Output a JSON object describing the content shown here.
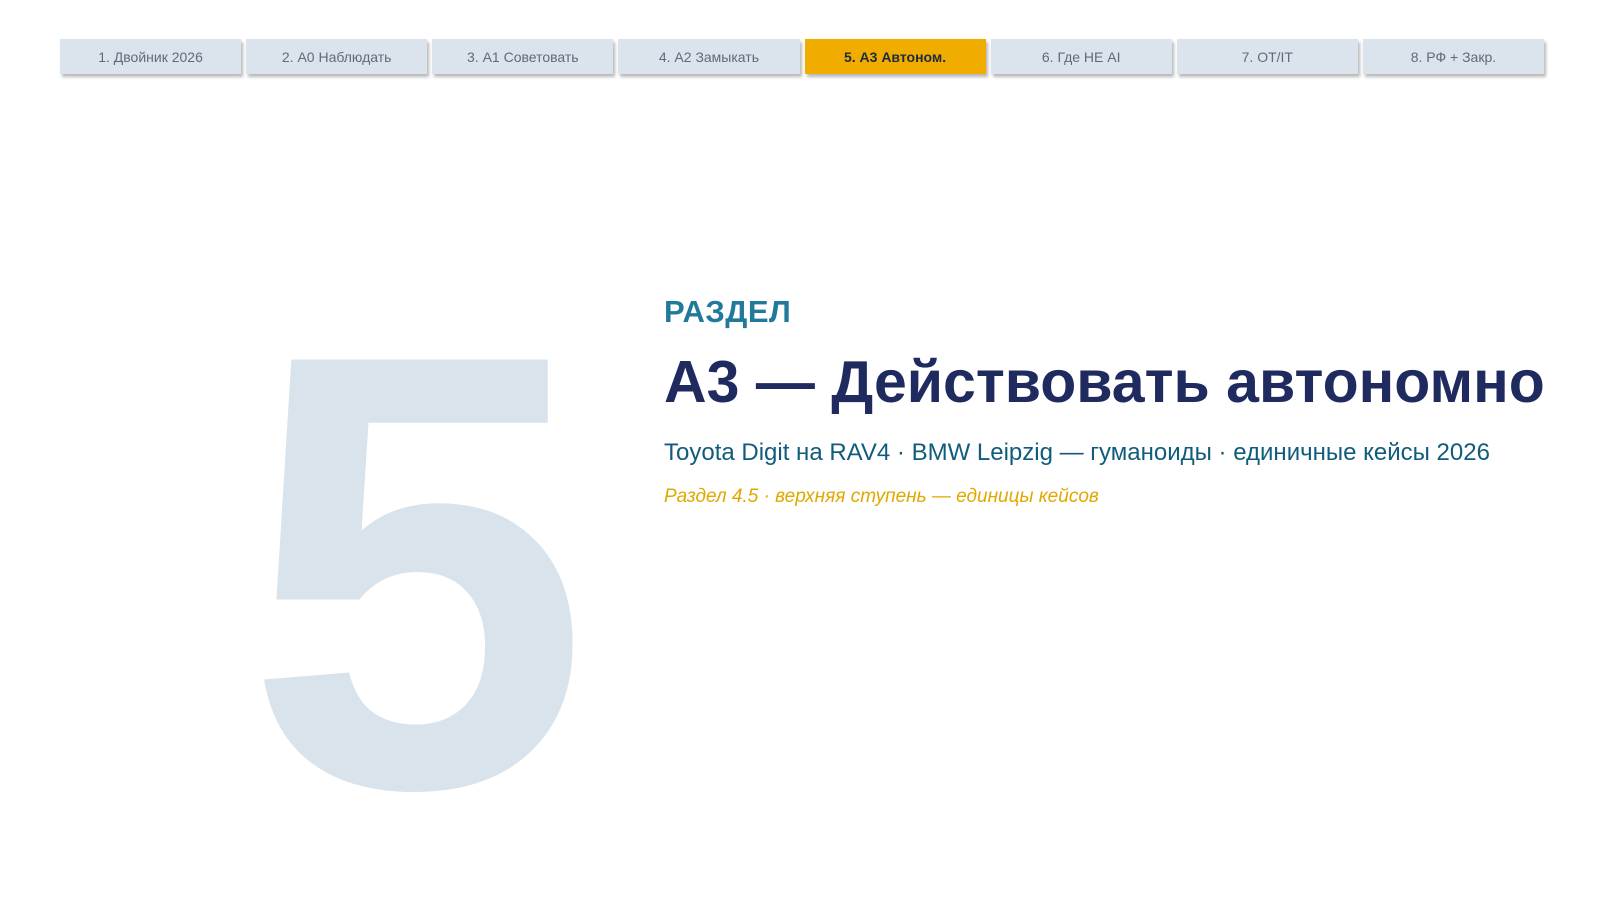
{
  "nav": {
    "tabs": [
      {
        "label": "1. Двойник 2026"
      },
      {
        "label": "2. А0 Наблюдать"
      },
      {
        "label": "3. А1 Советовать"
      },
      {
        "label": "4. А2 Замыкать"
      },
      {
        "label": "5. А3 Автоном."
      },
      {
        "label": "6. Где НЕ AI"
      },
      {
        "label": "7. OT/IT"
      },
      {
        "label": "8. РФ + Закр."
      }
    ],
    "active_index": 4
  },
  "section": {
    "number": "5",
    "label": "РАЗДЕЛ",
    "title": "А3 — Действовать автономно",
    "subtitle": "Toyota Digit на RAV4 · BMW Leipzig — гуманоиды · единичные кейсы 2026",
    "note": "Раздел 4.5 · верхняя ступень — единицы кейсов"
  },
  "colors": {
    "active_tab": "#f0ad00",
    "inactive_tab": "#dbe4ec",
    "big_number": "#d9e3ec",
    "label": "#217a9c",
    "title": "#1f2a5e",
    "subtitle": "#115c7c",
    "note": "#e0a800"
  }
}
